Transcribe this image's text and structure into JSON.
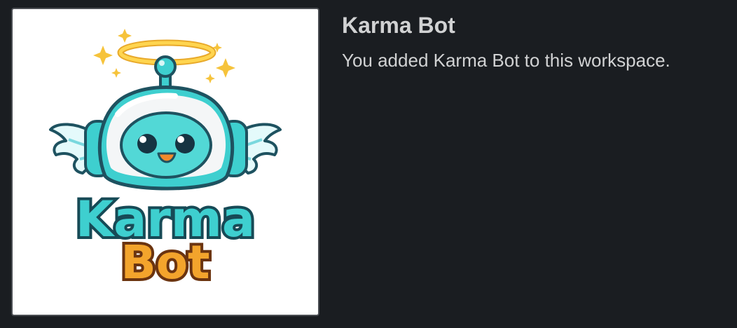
{
  "profile": {
    "name": "Karma Bot",
    "description": "You added Karma Bot to this workspace."
  },
  "avatar": {
    "logo_line1": "Karma",
    "logo_line2": "Bot"
  },
  "colors": {
    "background": "#1a1d21",
    "text": "#d1d2d3",
    "teal": "#3ecfcf",
    "halo": "#f6c33b",
    "logo_orange": "#f3a42c"
  }
}
